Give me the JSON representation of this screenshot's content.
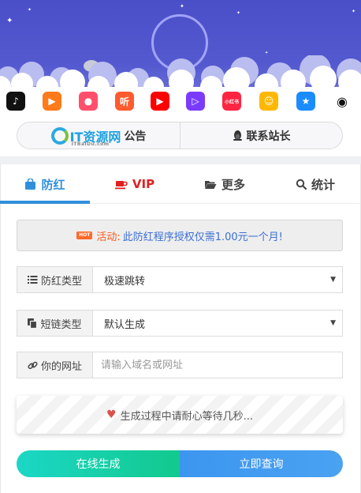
{
  "colors": {
    "sky": "#4a4fc8",
    "accent_blue": "#2f8fdc",
    "vip_red": "#e02020",
    "notice_orange": "#ff5a1e",
    "notice_blue": "#3c6fd6",
    "generate_green": "#12c98d",
    "query_blue": "#3c96ef"
  },
  "apps": [
    {
      "name": "douyin-app-icon",
      "glyph": "♪",
      "bg": "#111111"
    },
    {
      "name": "kuaishou-app-icon",
      "glyph": "▶",
      "bg": "#ff7a1a"
    },
    {
      "name": "pipixia-app-icon",
      "glyph": "●",
      "bg": "#ff4f6a"
    },
    {
      "name": "huoshan-app-icon",
      "glyph": "听",
      "bg": "#ff5b2e"
    },
    {
      "name": "youtube-app-icon",
      "glyph": "▶",
      "bg": "#ff0000"
    },
    {
      "name": "video-app-icon",
      "glyph": "▷",
      "bg": "#7a3bff"
    },
    {
      "name": "xiaohongshu-app-icon",
      "glyph": "小红书",
      "bg": "#ff2442"
    },
    {
      "name": "meme-app-icon",
      "glyph": "☺",
      "bg": "#ffb800"
    },
    {
      "name": "favorite-app-icon",
      "glyph": "★",
      "bg": "#1a8cff"
    },
    {
      "name": "qq-app-icon",
      "glyph": "◉",
      "bg": "#ffffff"
    }
  ],
  "header": {
    "logo_text": "IT资源网",
    "logo_sub": "ITBaiDu.com",
    "notice_label": "公告",
    "contact_label": "联系站长"
  },
  "tabs": [
    {
      "label": "防红",
      "icon": "shopping-bag-icon",
      "active": true
    },
    {
      "label": "VIP",
      "icon": "coffee-cup-icon",
      "active": false
    },
    {
      "label": "更多",
      "icon": "folder-open-icon",
      "active": false
    },
    {
      "label": "统计",
      "icon": "search-icon",
      "active": false
    }
  ],
  "notice": {
    "badge": "HOT",
    "label": "活动:",
    "text": "此防红程序授权仅需1.00元一个月!"
  },
  "form": {
    "type": {
      "label": "防红类型",
      "value": "极速跳转"
    },
    "shortlink": {
      "label": "短链类型",
      "value": "默认生成"
    },
    "url": {
      "label": "你的网址",
      "placeholder": "请输入域名或网址",
      "value": ""
    }
  },
  "wait_message": "生成过程中请耐心等待几秒...",
  "buttons": {
    "generate": "在线生成",
    "query": "立即查询"
  }
}
